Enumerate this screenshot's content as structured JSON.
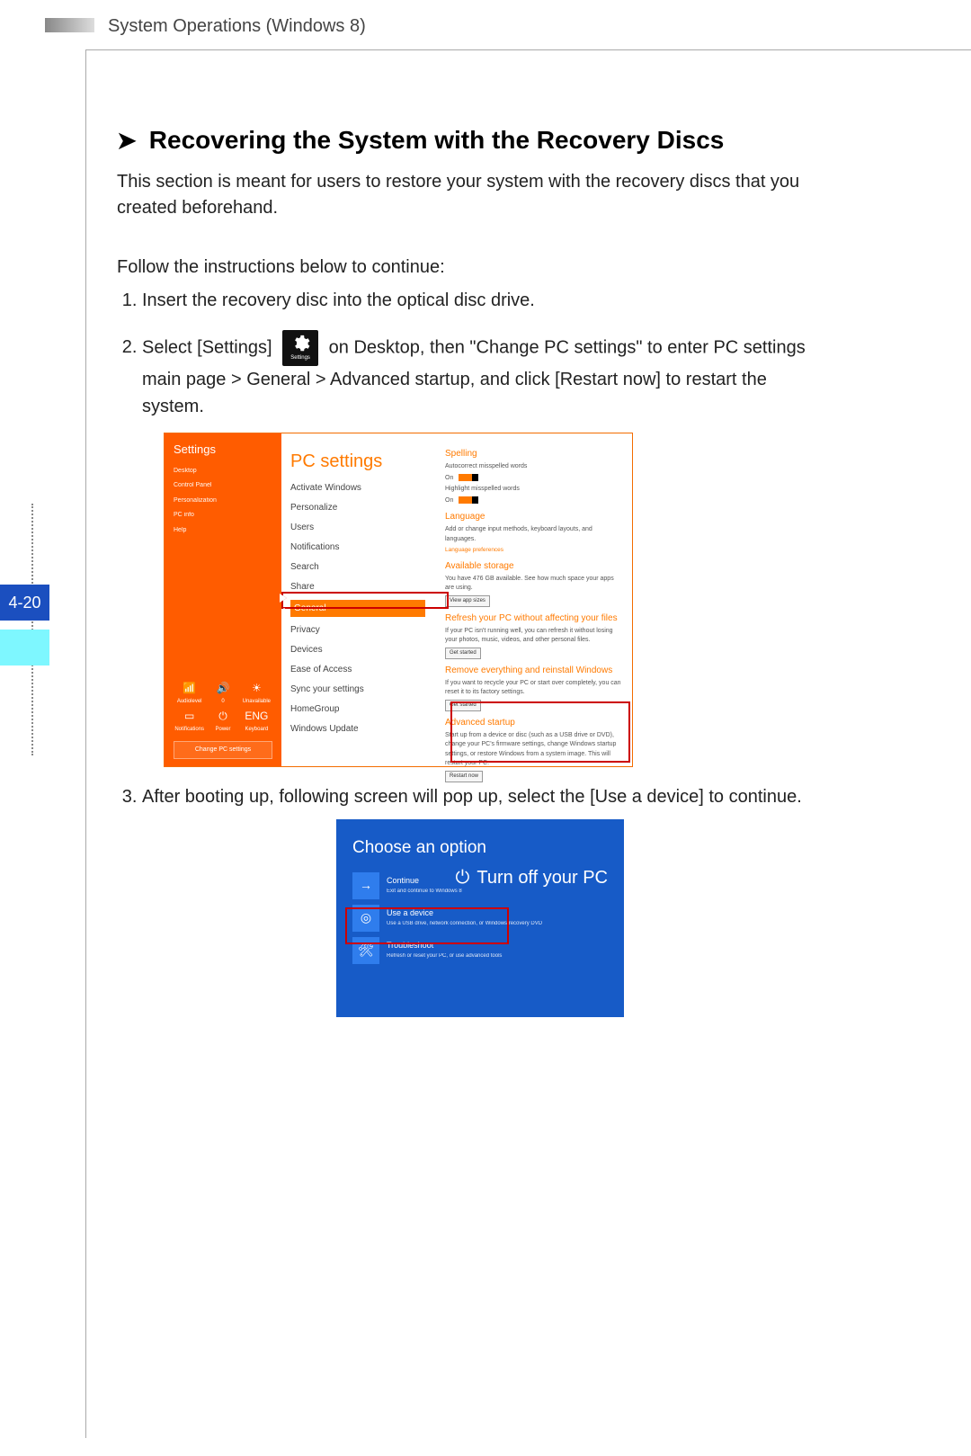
{
  "header": "System Operations (Windows 8)",
  "page_number": "4-20",
  "title": "Recovering the System with the Recovery Discs",
  "intro": "This section is meant for users to restore your system with the recovery discs that you created beforehand.",
  "follow": "Follow the instructions below to continue:",
  "steps": {
    "s1": "Insert the recovery disc into the optical disc drive.",
    "s2_a": "Select [Settings]",
    "s2_b": "on Desktop, then \"Change PC settings\" to enter PC settings main page > General > Advanced startup,  and click [Restart now] to restart the system.",
    "s3": "After booting up, following screen will pop up, select the [Use a device] to continue."
  },
  "settings_tile_label": "Settings",
  "pc_settings": {
    "charm_title": "Settings",
    "charm_items": [
      "Desktop",
      "Control Panel",
      "Personalization",
      "PC info",
      "Help"
    ],
    "charm_tiles": [
      "Audiolevel",
      "0",
      "Unavailable",
      "Notifications",
      "Power",
      "Keyboard"
    ],
    "charm_tile_icons": [
      "📶",
      "🔊",
      "☀",
      "▭",
      "⏻",
      "ENG"
    ],
    "change_pc": "Change PC settings",
    "heading": "PC settings",
    "nav": [
      "Activate Windows",
      "Personalize",
      "Users",
      "Notifications",
      "Search",
      "Share",
      "General",
      "Privacy",
      "Devices",
      "Ease of Access",
      "Sync your settings",
      "HomeGroup",
      "Windows Update"
    ],
    "nav_selected": "General",
    "sections": {
      "spelling": {
        "h": "Spelling",
        "a": "Autocorrect misspelled words",
        "b": "Highlight misspelled words",
        "on": "On"
      },
      "language": {
        "h": "Language",
        "a": "Add or change input methods, keyboard layouts, and languages.",
        "link": "Language preferences"
      },
      "storage": {
        "h": "Available storage",
        "a": "You have 476 GB available. See how much space your apps are using.",
        "btn": "View app sizes"
      },
      "refresh": {
        "h": "Refresh your PC without affecting your files",
        "a": "If your PC isn't running well, you can refresh it without losing your photos, music, videos, and other personal files.",
        "btn": "Get started"
      },
      "remove": {
        "h": "Remove everything and reinstall Windows",
        "a": "If you want to recycle your PC or start over completely, you can reset it to its factory settings.",
        "btn": "Get started"
      },
      "advanced": {
        "h": "Advanced startup",
        "a": "Start up from a device or disc (such as a USB drive or DVD), change your PC's firmware settings, change Windows startup settings, or restore Windows from a system image. This will restart your PC.",
        "btn": "Restart now"
      }
    }
  },
  "choose": {
    "title": "Choose an option",
    "continue": {
      "t": "Continue",
      "s": "Exit and continue to Windows 8"
    },
    "turnoff": "Turn off your PC",
    "device": {
      "t": "Use a device",
      "s": "Use a USB drive, network connection, or Windows recovery DVD"
    },
    "troubleshoot": {
      "t": "Troubleshoot",
      "s": "Refresh or reset your PC, or use advanced tools"
    }
  }
}
